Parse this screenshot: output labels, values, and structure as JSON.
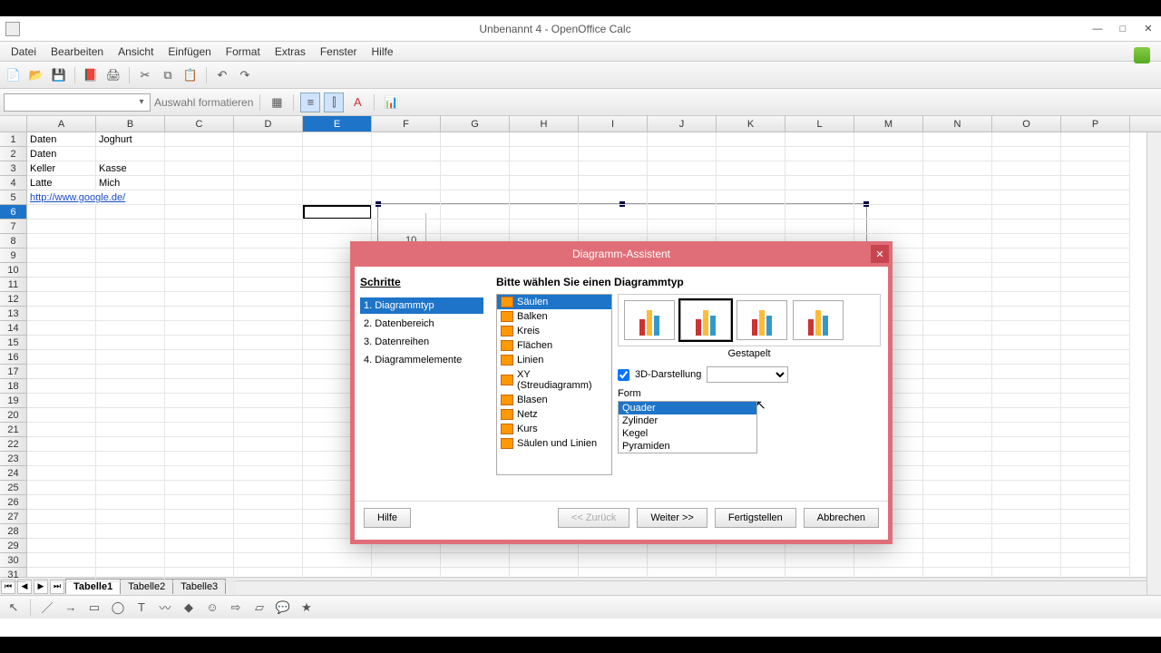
{
  "window": {
    "title": "Unbenannt 4 - OpenOffice Calc"
  },
  "menu": [
    "Datei",
    "Bearbeiten",
    "Ansicht",
    "Einfügen",
    "Format",
    "Extras",
    "Fenster",
    "Hilfe"
  ],
  "formatbar": {
    "auswahl": "Auswahl formatieren"
  },
  "columns": [
    "A",
    "B",
    "C",
    "D",
    "E",
    "F",
    "G",
    "H",
    "I",
    "J",
    "K",
    "L",
    "M",
    "N",
    "O",
    "P"
  ],
  "selected_col": "E",
  "selected_row": 6,
  "rows": 31,
  "cells": {
    "A1": "Daten",
    "B1": "Joghurt",
    "A2": "Daten",
    "A3": "Keller",
    "B3": "Kasse",
    "A4": "Latte",
    "B4": "Mich",
    "A5": "http://www.google.de/"
  },
  "link_cells": [
    "A5"
  ],
  "sheet_tabs": [
    "Tabelle1",
    "Tabelle2",
    "Tabelle3"
  ],
  "active_tab": 0,
  "dialog": {
    "title": "Diagramm-Assistent",
    "steps_header": "Schritte",
    "steps": [
      "1. Diagrammtyp",
      "2. Datenbereich",
      "3. Datenreihen",
      "4. Diagrammelemente"
    ],
    "active_step": 0,
    "choose_label": "Bitte wählen Sie einen Diagrammtyp",
    "types": [
      "Säulen",
      "Balken",
      "Kreis",
      "Flächen",
      "Linien",
      "XY (Streudiagramm)",
      "Blasen",
      "Netz",
      "Kurs",
      "Säulen und Linien"
    ],
    "selected_type": 0,
    "subtype_label": "Gestapelt",
    "selected_thumb": 1,
    "option_3d": "3D-Darstellung",
    "option_3d_checked": true,
    "form_label": "Form",
    "forms": [
      "Quader",
      "Zylinder",
      "Kegel",
      "Pyramiden"
    ],
    "selected_form": 0,
    "buttons": {
      "help": "Hilfe",
      "back": "<< Zurück",
      "next": "Weiter >>",
      "finish": "Fertigstellen",
      "cancel": "Abbrechen"
    }
  }
}
